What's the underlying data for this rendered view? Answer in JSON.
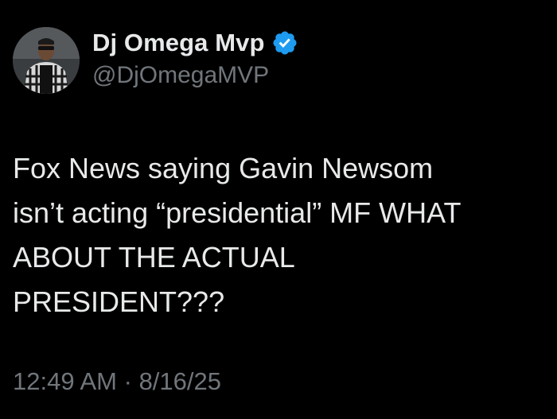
{
  "author": {
    "display_name": "Dj Omega Mvp",
    "handle": "@DjOmegaMVP",
    "verified": true,
    "verified_icon": "verified-badge-icon"
  },
  "tweet": {
    "lines": [
      "Fox News saying Gavin Newsom",
      "isn’t acting “presidential” MF WHAT",
      "ABOUT THE ACTUAL",
      "PRESIDENT???"
    ],
    "time": "12:49 AM",
    "separator": "·",
    "date": "8/16/25"
  },
  "colors": {
    "background": "#000000",
    "primary_text": "#e7e9ea",
    "secondary_text": "#71767b",
    "verified_blue": "#1d9bf0"
  }
}
